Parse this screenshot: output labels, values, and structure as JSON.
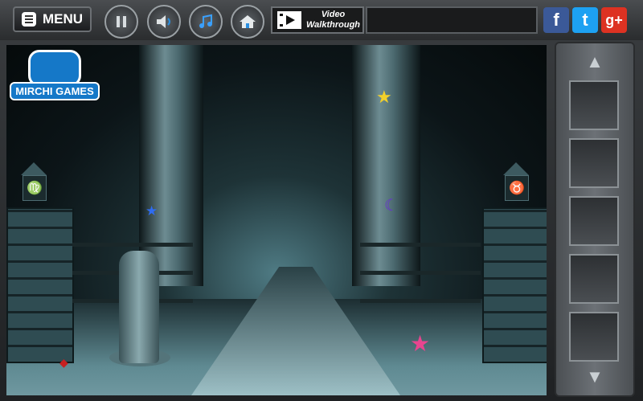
{
  "topbar": {
    "menu_label": "MENU",
    "video_line1": "Video",
    "video_line2": "Walkthrough",
    "social": {
      "facebook_label": "f",
      "twitter_label": "t",
      "gplus_label": "g+"
    }
  },
  "scene": {
    "logo_text": "MIRCHI GAMES"
  },
  "colors": {
    "logo_blue": "#1578c8",
    "facebook": "#3b5998",
    "twitter": "#1da1f2",
    "gplus": "#dd3222",
    "star_yellow": "#f2d02a",
    "star_blue": "#2f6cf0",
    "star_pink": "#e8458f",
    "moon_purple": "#6a2bd8"
  },
  "inventory": {
    "slot_count": 5
  }
}
